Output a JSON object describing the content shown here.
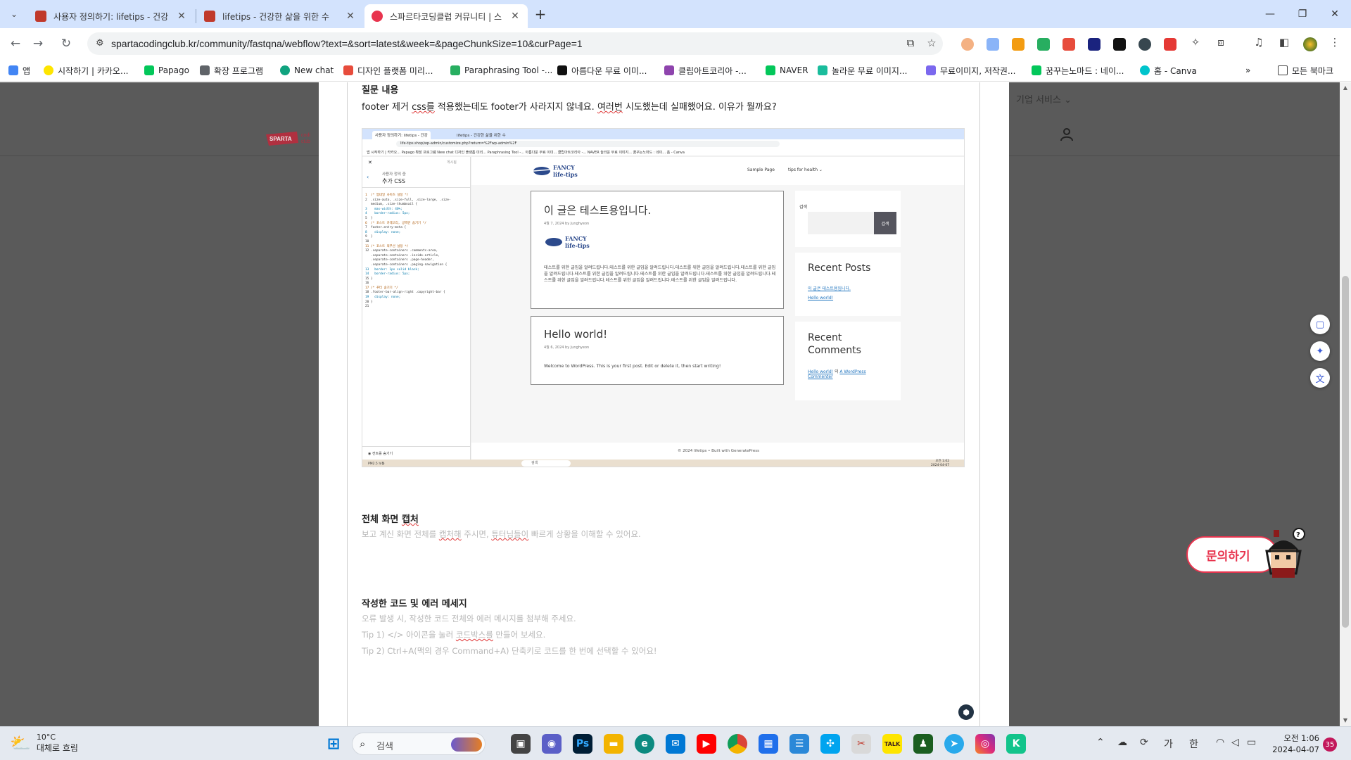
{
  "browser": {
    "tabs": [
      {
        "title": "사용자 정의하기: lifetips - 건강",
        "favicon_color": "#c0392b"
      },
      {
        "title": "lifetips - 건강한 삶을 위한 수",
        "favicon_color": "#c0392b"
      },
      {
        "title": "스파르타코딩클럽 커뮤니티 | 스",
        "favicon_color": "#e8344e"
      }
    ],
    "url": "spartacodingclub.kr/community/fastqna/webflow?text=&sort=latest&week=&pageChunkSize=10&curPage=1",
    "bookmarks": [
      {
        "label": "앱",
        "color": "#4285f4"
      },
      {
        "label": "시작하기 | 카카오...",
        "color": "#fee500"
      },
      {
        "label": "Papago",
        "color": "#03c75a"
      },
      {
        "label": "확장 프로그램",
        "color": "#5f6368"
      },
      {
        "label": "New chat",
        "color": "#10a37f"
      },
      {
        "label": "디자인 플랫폼 미리...",
        "color": "#e74c3c"
      },
      {
        "label": "Paraphrasing Tool -...",
        "color": "#27ae60"
      },
      {
        "label": "아름다운 무료 이미...",
        "color": "#111111"
      },
      {
        "label": "클립아트코리아 -...",
        "color": "#8e44ad"
      },
      {
        "label": "NAVER",
        "color": "#03c75a"
      },
      {
        "label": "놀라운 무료 이미지...",
        "color": "#1abc9c"
      },
      {
        "label": "무료이미지, 저작권...",
        "color": "#7b68ee"
      },
      {
        "label": "꿈꾸는노마드 : 네이...",
        "color": "#03c75a"
      },
      {
        "label": "홈 - Canva",
        "color": "#00c4cc"
      }
    ],
    "all_bookmarks": "모든 북마크"
  },
  "page": {
    "corp_service": "기업 서비스",
    "sections": {
      "question_title": "질문 내용",
      "question_body_1": "footer 제거 ",
      "question_body_css": "css를",
      "question_body_2": " 적용했는데도 footer가 사라지지 않네요. ",
      "question_body_many": "여러번",
      "question_body_3": " 시도했는데 실패했어요. 이유가 뭘까요?",
      "capture_title_1": "전체 화면 ",
      "capture_title_squig": "캡처",
      "capture_hint_1": "보고 계신 화면 전체를 ",
      "capture_hint_squig1": "캡처해",
      "capture_hint_2": " 주시면, ",
      "capture_hint_squig2": "튜터님들이",
      "capture_hint_3": " 빠르게 상황을 이해할 수 있어요.",
      "code_title": "작성한 코드 및 에러 메세지",
      "code_hint_1": "오류 발생 시, 작성한 코드 전체와 에러 메시지를 첨부해 주세요.",
      "code_hint_2a": "Tip 1) </> 아이콘을 눌러 ",
      "code_hint_2squig": "코드박스를",
      "code_hint_2b": " 만들어 보세요.",
      "code_hint_3": "Tip 2) Ctrl+A(맥의 경우 Command+A) 단축키로 코드를 한 번에 선택할 수 있어요!"
    },
    "inquiry_button": "문의하기",
    "screenshot": {
      "tab1": "사용자 정의하기: lifetips - 건강",
      "tab2": "lifetips - 건강한 삶을 위한 수",
      "url": "life-tips.shop/wp-admin/customize.php?return=%2Fwp-admin%2F",
      "bookmarks": "앱   시작하기 | 카카오...   Papago   확장 프로그램   New chat   디자인 플랫폼 미리...   Paraphrasing Tool -...   아름다운 무료 이미...   클립아트코리아 -...   NAVER   놀라운 무료 이미지...   꿈꾸는노마드 : 네이...   홈 - Canva",
      "publish": "게시됨",
      "panel_sub": "사용자 정의 중",
      "panel_title": "추가 CSS",
      "hide_controls": "컨트롤 숨기기",
      "code_lines": [
        "1  /* 썸네일 사이즈 설정 */",
        "2  .size-auto, .size-full, .size-large, .size-",
        "   medium, .size-thumbnail {",
        "3    max-width: 40%;",
        "4    border-radius: 5px;",
        "5  }",
        "6  /* 포스트 카테고리, 공백란 숨기기 */",
        "7  footer.entry-meta {",
        "8    display: none;",
        "9  }",
        "10",
        "11 /* 포스트 외부선 설정 */",
        "12 .separate-containers .comments-area,",
        "   .separate-containers .inside-article,",
        "   .separate-containers .page-header,",
        "   .separate-containers .paging-navigation {",
        "13   border: 1px solid black;",
        "14   border-radius: 5px;",
        "15 }",
        "16",
        "17 /* 푸터 숨기기 */",
        "18 .footer-bar-align-right .copyright-bar {",
        "19   display: none;",
        "20 }",
        "21"
      ],
      "logo_line1": "FANCY",
      "logo_line2": "life-tips",
      "nav_sample": "Sample Page",
      "nav_tips": "tips for health ⌄",
      "post1_title": "이 글은 테스트용입니다.",
      "post1_meta": "4월 7, 2024 by Junghyeon",
      "post1_text": "테스트를 위한 글임을 알려드립니다.테스트를 위한 글임을 알려드립니다.테스트를 위한 글임을 알려드립니다.테스트를 위한 글임을 알려드립니다.테스트를 위한 글임을 알려드립니다.테스트를 위한 글임을 알려드립니다.테스트를 위한 글임을 알려드립니다.테스트를 위한 글임을 알려드립니다.테스트를 위한 글임을 알려드립니다.테스트를 위한 글임을 알려드립니다.",
      "post2_title": "Hello world!",
      "post2_meta": "4월 6, 2024 by Junghyeon",
      "post2_text": "Welcome to WordPress. This is your first post. Edit or delete it, then start writing!",
      "search_label": "검색",
      "search_button": "검색",
      "recent_posts": "Recent Posts",
      "recent_post_1": "이 글은 테스트용입니다.",
      "recent_post_2": "Hello world!",
      "recent_comments": "Recent Comments",
      "comment_author": "Hello world!",
      "comment_mid": " 의 ",
      "comment_link": "A WordPress Commenter",
      "footer": "© 2024 lifetips • Built with GeneratePress",
      "task_weather": "PM2.5 보통",
      "task_search": "검색",
      "task_time": "오전 1:02",
      "task_date": "2024-04-07"
    }
  },
  "taskbar": {
    "temperature": "10°C",
    "weather": "대체로 흐림",
    "search_placeholder": "검색",
    "ime_ga": "가",
    "ime_han": "한",
    "time": "오전 1:06",
    "date": "2024-04-07",
    "notifications": "35"
  }
}
